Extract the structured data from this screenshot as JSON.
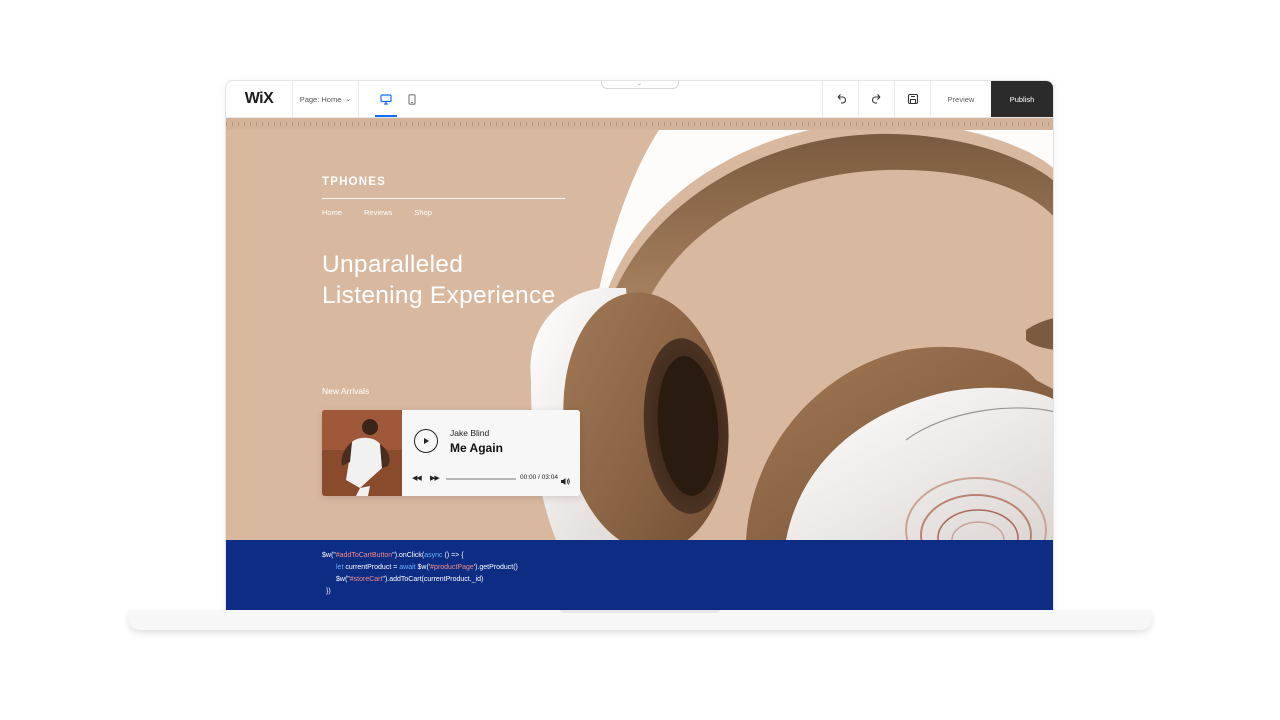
{
  "editor": {
    "logo": "WiX",
    "page_selector": "Page: Home",
    "toolbar": {
      "preview_label": "Preview",
      "publish_label": "Publish"
    },
    "active_device": "desktop",
    "icons": {
      "desktop": "desktop-icon",
      "mobile": "mobile-icon",
      "undo": "undo-icon",
      "redo": "redo-icon",
      "save": "save-icon"
    }
  },
  "site": {
    "brand": "TPHONES",
    "nav": [
      "Home",
      "Reviews",
      "Shop"
    ],
    "hero_line1": "Unparalleled",
    "hero_line2": "Listening Experience",
    "new_arrivals": "New Arrivals",
    "background_color": "#d8b9a0"
  },
  "player": {
    "artist": "Jake Blind",
    "song": "Me Again",
    "time": "00:00 / 03:04",
    "progress": 0
  },
  "code": {
    "background": "#0c2d83",
    "lines": [
      "$w(\"#addToCartButton\").onClick(async () => {",
      "let currentProduct = await $w('#productPage').getProduct()",
      "$w(\"#storeCart\").addToCart(currentProduct._id)",
      "})"
    ]
  }
}
